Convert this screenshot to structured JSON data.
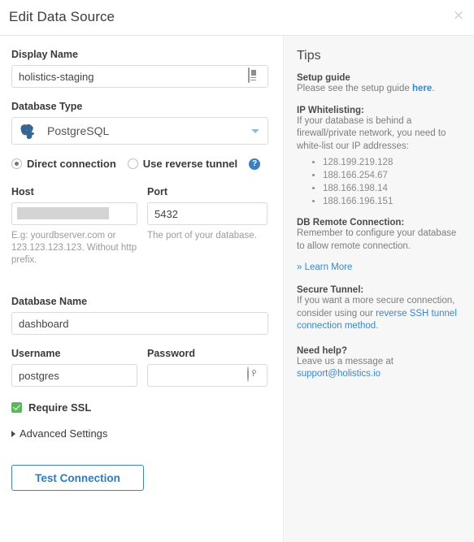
{
  "header": {
    "title": "Edit Data Source",
    "close_label": "×"
  },
  "form": {
    "display_name": {
      "label": "Display Name",
      "value": "holistics-staging",
      "icon": "lastpass-card-icon"
    },
    "database_type": {
      "label": "Database Type",
      "selected": "PostgreSQL",
      "icon": "postgresql-elephant-icon",
      "caret": "chevron-down-icon"
    },
    "connection_mode": {
      "direct_label": "Direct connection",
      "reverse_label": "Use reverse tunnel",
      "selected": "direct",
      "help_glyph": "?"
    },
    "host": {
      "label": "Host",
      "value": "",
      "redacted": true,
      "hint": "E.g: yourdbserver.com or 123.123.123.123. Without http prefix."
    },
    "port": {
      "label": "Port",
      "value": "5432",
      "hint": "The port of your database."
    },
    "database_name": {
      "label": "Database Name",
      "value": "dashboard"
    },
    "username": {
      "label": "Username",
      "value": "postgres"
    },
    "password": {
      "label": "Password",
      "value": "",
      "icon": "lastpass-key-icon"
    },
    "require_ssl": {
      "label": "Require SSL",
      "checked": true
    },
    "advanced_settings": {
      "label": "Advanced Settings",
      "expanded": false
    },
    "test_connection": {
      "label": "Test Connection"
    }
  },
  "tips": {
    "title": "Tips",
    "setup_guide": {
      "heading": "Setup guide",
      "text_before": "Please see the setup guide ",
      "link": "here",
      "text_after": "."
    },
    "ip_whitelisting": {
      "heading": "IP Whitelisting:",
      "text": "If your database is behind a firewall/private network, you need to white-list our IP addresses:",
      "ips": [
        "128.199.219.128",
        "188.166.254.67",
        "188.166.198.14",
        "188.166.196.151"
      ]
    },
    "db_remote": {
      "heading": "DB Remote Connection:",
      "text": "Remember to configure your database to allow remote connection.",
      "learn_more": "» Learn More"
    },
    "secure_tunnel": {
      "heading": "Secure Tunnel:",
      "text_before": "If you want a more secure connection, consider using our ",
      "link": "reverse SSH tunnel connection method",
      "text_after": "."
    },
    "need_help": {
      "heading": "Need help?",
      "text_before": "Leave us a message at ",
      "email": "support@holistics.io"
    }
  },
  "colors": {
    "accent_blue": "#3a87c8",
    "button_blue": "#2f7cbe",
    "success_green": "#5cb85c",
    "tips_bg": "#f7f7f7"
  }
}
